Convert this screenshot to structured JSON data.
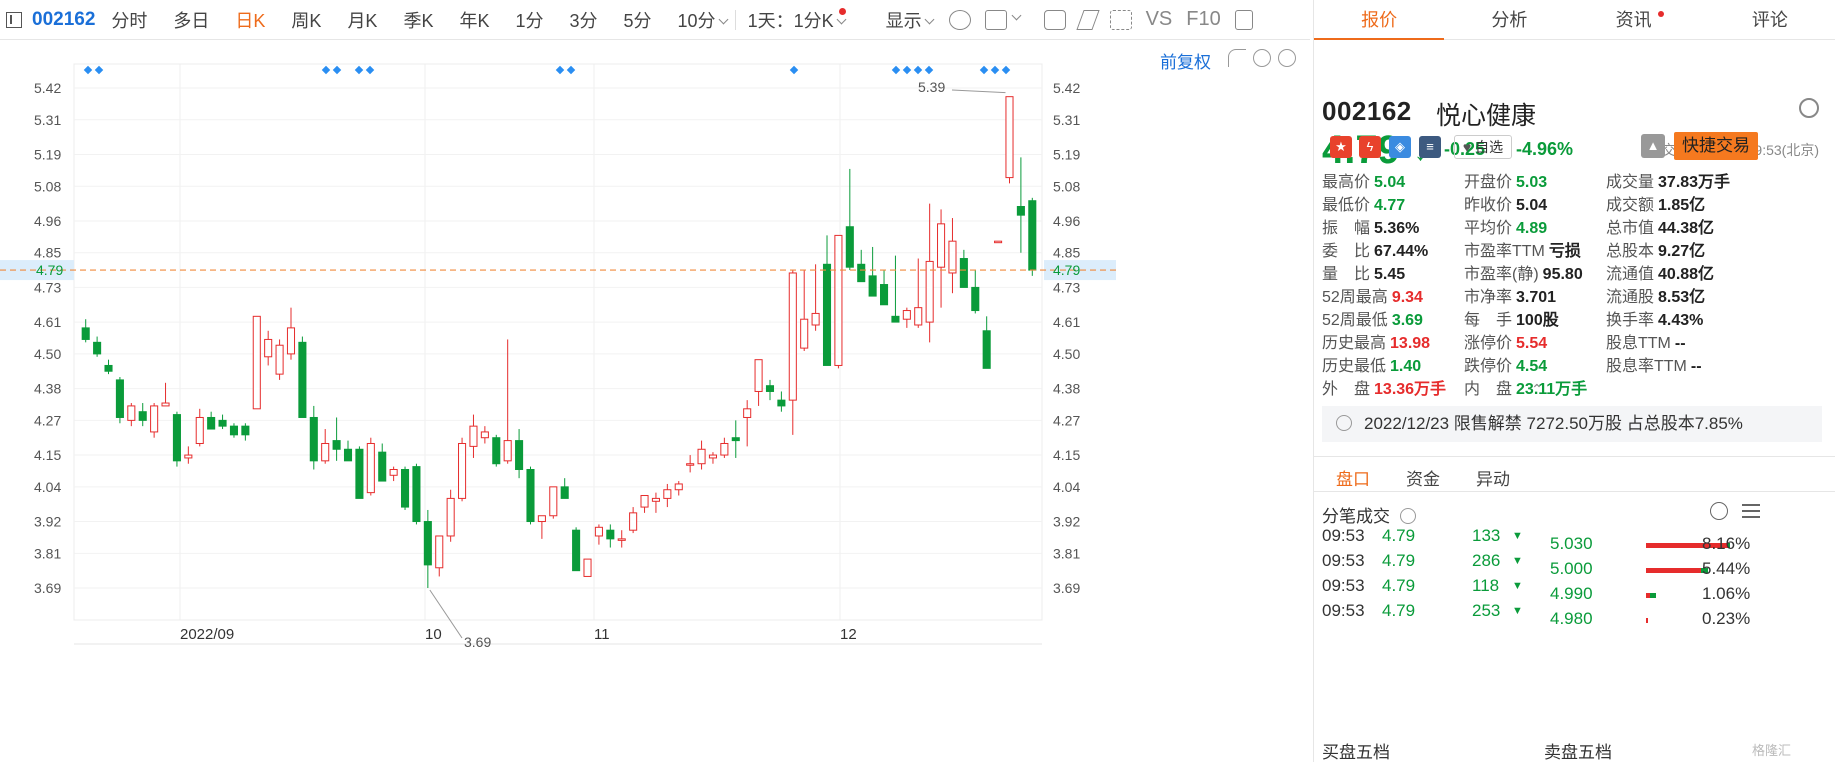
{
  "toolbar": {
    "code": "002162",
    "periods": [
      "分时",
      "多日",
      "日K",
      "周K",
      "月K",
      "季K",
      "年K",
      "1分",
      "3分",
      "5分",
      "10分"
    ],
    "active_period": "日K",
    "range": "1天：1分K",
    "display": "显示",
    "vs": "VS",
    "f10": "F10"
  },
  "chart": {
    "adjust_label": "前复权",
    "high_marker": "5.39",
    "low_marker": "3.69",
    "current_price_label": "4.79"
  },
  "chart_data": {
    "type": "candlestick",
    "y_ticks": [
      "5.42",
      "5.31",
      "5.19",
      "5.08",
      "4.96",
      "4.85",
      "4.73",
      "4.61",
      "4.50",
      "4.38",
      "4.27",
      "4.15",
      "4.04",
      "3.92",
      "3.81",
      "3.69"
    ],
    "x_ticks": [
      "2022/09",
      "10",
      "11",
      "12"
    ],
    "ylim": [
      3.69,
      5.42
    ],
    "grid": true,
    "current_price": 4.79,
    "candles": [
      [
        4.59,
        4.62,
        4.54,
        4.55
      ],
      [
        4.54,
        4.56,
        4.49,
        4.5
      ],
      [
        4.46,
        4.48,
        4.43,
        4.44
      ],
      [
        4.41,
        4.42,
        4.26,
        4.28
      ],
      [
        4.27,
        4.33,
        4.25,
        4.32
      ],
      [
        4.3,
        4.33,
        4.25,
        4.27
      ],
      [
        4.23,
        4.33,
        4.21,
        4.32
      ],
      [
        4.32,
        4.4,
        4.32,
        4.33
      ],
      [
        4.29,
        4.3,
        4.11,
        4.13
      ],
      [
        4.14,
        4.18,
        4.12,
        4.15
      ],
      [
        4.19,
        4.31,
        4.18,
        4.28
      ],
      [
        4.28,
        4.3,
        4.24,
        4.24
      ],
      [
        4.27,
        4.29,
        4.24,
        4.25
      ],
      [
        4.25,
        4.26,
        4.21,
        4.22
      ],
      [
        4.25,
        4.26,
        4.2,
        4.22
      ],
      [
        4.31,
        4.63,
        4.31,
        4.63
      ],
      [
        4.49,
        4.58,
        4.46,
        4.55
      ],
      [
        4.43,
        4.55,
        4.41,
        4.53
      ],
      [
        4.5,
        4.66,
        4.48,
        4.59
      ],
      [
        4.54,
        4.56,
        4.28,
        4.28
      ],
      [
        4.28,
        4.32,
        4.1,
        4.13
      ],
      [
        4.13,
        4.24,
        4.12,
        4.19
      ],
      [
        4.2,
        4.28,
        4.13,
        4.17
      ],
      [
        4.17,
        4.2,
        4.13,
        4.13
      ],
      [
        4.17,
        4.18,
        4.0,
        4.0
      ],
      [
        4.02,
        4.21,
        4.01,
        4.19
      ],
      [
        4.16,
        4.19,
        4.06,
        4.06
      ],
      [
        4.08,
        4.11,
        4.06,
        4.1
      ],
      [
        4.1,
        4.11,
        3.96,
        3.97
      ],
      [
        4.11,
        4.12,
        3.91,
        3.92
      ],
      [
        3.92,
        3.96,
        3.69,
        3.77
      ],
      [
        3.76,
        3.87,
        3.73,
        3.87
      ],
      [
        3.87,
        4.03,
        3.85,
        4.0
      ],
      [
        4.0,
        4.21,
        3.99,
        4.19
      ],
      [
        4.18,
        4.29,
        4.14,
        4.25
      ],
      [
        4.21,
        4.25,
        4.19,
        4.23
      ],
      [
        4.21,
        4.22,
        4.11,
        4.12
      ],
      [
        4.13,
        4.55,
        4.12,
        4.2
      ],
      [
        4.2,
        4.24,
        4.07,
        4.1
      ],
      [
        4.1,
        4.11,
        3.91,
        3.92
      ],
      [
        3.92,
        3.93,
        3.86,
        3.94
      ],
      [
        3.94,
        4.0,
        3.93,
        4.04
      ],
      [
        4.04,
        4.07,
        4.03,
        4.0
      ],
      [
        3.89,
        3.9,
        3.76,
        3.75
      ],
      [
        3.73,
        3.79,
        3.73,
        3.79
      ],
      [
        3.87,
        3.91,
        3.84,
        3.9
      ],
      [
        3.89,
        3.91,
        3.83,
        3.86
      ],
      [
        3.86,
        3.89,
        3.83,
        3.86
      ],
      [
        3.89,
        3.97,
        3.88,
        3.95
      ],
      [
        3.97,
        4.01,
        3.95,
        4.01
      ],
      [
        3.99,
        4.02,
        3.95,
        4.0
      ],
      [
        4.0,
        4.05,
        3.97,
        4.03
      ],
      [
        4.03,
        4.06,
        4.01,
        4.05
      ],
      [
        4.12,
        4.15,
        4.09,
        4.12
      ],
      [
        4.12,
        4.2,
        4.1,
        4.17
      ],
      [
        4.14,
        4.16,
        4.12,
        4.15
      ],
      [
        4.15,
        4.21,
        4.14,
        4.19
      ],
      [
        4.21,
        4.27,
        4.14,
        4.2
      ],
      [
        4.28,
        4.34,
        4.18,
        4.31
      ],
      [
        4.37,
        4.46,
        4.32,
        4.48
      ],
      [
        4.39,
        4.41,
        4.34,
        4.37
      ],
      [
        4.34,
        4.37,
        4.3,
        4.32
      ],
      [
        4.34,
        4.79,
        4.22,
        4.78
      ],
      [
        4.52,
        4.79,
        4.51,
        4.62
      ],
      [
        4.6,
        4.81,
        4.58,
        4.64
      ],
      [
        4.81,
        4.91,
        4.46,
        4.46
      ],
      [
        4.46,
        4.91,
        4.45,
        4.91
      ],
      [
        4.94,
        5.14,
        4.79,
        4.8
      ],
      [
        4.81,
        4.86,
        4.77,
        4.75
      ],
      [
        4.77,
        4.87,
        4.76,
        4.7
      ],
      [
        4.74,
        4.79,
        4.68,
        4.67
      ],
      [
        4.63,
        4.84,
        4.61,
        4.61
      ],
      [
        4.62,
        4.66,
        4.59,
        4.65
      ],
      [
        4.6,
        4.83,
        4.59,
        4.66
      ],
      [
        4.61,
        5.02,
        4.54,
        4.82
      ],
      [
        4.8,
        5.0,
        4.66,
        4.95
      ],
      [
        4.78,
        4.97,
        4.71,
        4.89
      ],
      [
        4.83,
        4.86,
        4.73,
        4.73
      ],
      [
        4.73,
        4.79,
        4.64,
        4.65
      ],
      [
        4.58,
        4.63,
        4.45,
        4.45
      ],
      [
        4.89,
        4.89,
        4.89,
        4.89
      ],
      [
        5.11,
        5.39,
        5.09,
        5.39
      ],
      [
        5.01,
        5.18,
        4.85,
        4.98
      ],
      [
        5.03,
        5.04,
        4.77,
        4.79
      ]
    ]
  },
  "quote": {
    "tabs": [
      "报价",
      "分析",
      "资讯",
      "评论"
    ],
    "code": "002162",
    "name": "悦心健康",
    "price": "4.79",
    "change": "-0.25",
    "change_pct": "-4.96%",
    "status": "交易中 12/22 09:53(北京)",
    "watch_label": "自选",
    "trade_label": "快捷交易",
    "icons": [
      "china-flag-icon",
      "lightning-icon",
      "tag-icon",
      "note-icon",
      "heart-icon",
      "bell-icon"
    ],
    "stats": [
      {
        "label": "最高价",
        "value": "5.04",
        "color": "#0a9b3a"
      },
      {
        "label": "开盘价",
        "value": "5.03",
        "color": "#0a9b3a"
      },
      {
        "label": "成交量",
        "value": "37.83万手",
        "color": "#222"
      },
      {
        "label": "最低价",
        "value": "4.77",
        "color": "#0a9b3a"
      },
      {
        "label": "昨收价",
        "value": "5.04",
        "color": "#222"
      },
      {
        "label": "成交额",
        "value": "1.85亿",
        "color": "#222"
      },
      {
        "label": "振　幅",
        "value": "5.36%",
        "color": "#222"
      },
      {
        "label": "平均价",
        "value": "4.89",
        "color": "#0a9b3a"
      },
      {
        "label": "总市值",
        "value": "44.38亿",
        "color": "#222"
      },
      {
        "label": "委　比",
        "value": "67.44%",
        "color": "#222"
      },
      {
        "label": "市盈率TTM",
        "value": "亏损",
        "color": "#222"
      },
      {
        "label": "总股本",
        "value": "9.27亿",
        "color": "#222"
      },
      {
        "label": "量　比",
        "value": "5.45",
        "color": "#222"
      },
      {
        "label": "市盈率(静)",
        "value": "95.80",
        "color": "#222"
      },
      {
        "label": "流通值",
        "value": "40.88亿",
        "color": "#222"
      },
      {
        "label": "52周最高",
        "value": "9.34",
        "color": "#e62c2c"
      },
      {
        "label": "市净率",
        "value": "3.701",
        "color": "#222"
      },
      {
        "label": "流通股",
        "value": "8.53亿",
        "color": "#222"
      },
      {
        "label": "52周最低",
        "value": "3.69",
        "color": "#0a9b3a"
      },
      {
        "label": "每　手",
        "value": "100股",
        "color": "#222"
      },
      {
        "label": "换手率",
        "value": "4.43%",
        "color": "#222"
      },
      {
        "label": "历史最高",
        "value": "13.98",
        "color": "#e62c2c"
      },
      {
        "label": "涨停价",
        "value": "5.54",
        "color": "#e62c2c"
      },
      {
        "label": "股息TTM",
        "value": "--",
        "color": "#222"
      },
      {
        "label": "历史最低",
        "value": "1.40",
        "color": "#0a9b3a"
      },
      {
        "label": "跌停价",
        "value": "4.54",
        "color": "#0a9b3a"
      },
      {
        "label": "股息率TTM",
        "value": "--",
        "color": "#222"
      },
      {
        "label": "外　盘",
        "value": "13.36万手",
        "color": "#e62c2c"
      },
      {
        "label": "内　盘",
        "value": "23.11万手",
        "color": "#0a9b3a"
      }
    ],
    "notice": "2022/12/23  限售解禁 7272.50万股 占总股本7.85%",
    "sub_tabs": [
      "盘口",
      "资金",
      "异动"
    ],
    "ticks_title": "分笔成交",
    "ticks": [
      {
        "time": "09:53",
        "price": "4.79",
        "vol": "133"
      },
      {
        "time": "09:53",
        "price": "4.79",
        "vol": "286"
      },
      {
        "time": "09:53",
        "price": "4.79",
        "vol": "118"
      },
      {
        "time": "09:53",
        "price": "4.79",
        "vol": "253"
      }
    ],
    "depth": [
      {
        "price": "5.030",
        "pct": "8.16%",
        "red": 0.82,
        "green": 0.02
      },
      {
        "price": "5.000",
        "pct": "5.44%",
        "red": 0.55,
        "green": 0.07
      },
      {
        "price": "4.990",
        "pct": "1.06%",
        "red": 0.04,
        "green": 0.06
      },
      {
        "price": "4.980",
        "pct": "0.23%",
        "red": 0.02,
        "green": 0.0
      }
    ],
    "buy5": "买盘五档",
    "sell5": "卖盘五档",
    "watermark": "格隆汇"
  }
}
